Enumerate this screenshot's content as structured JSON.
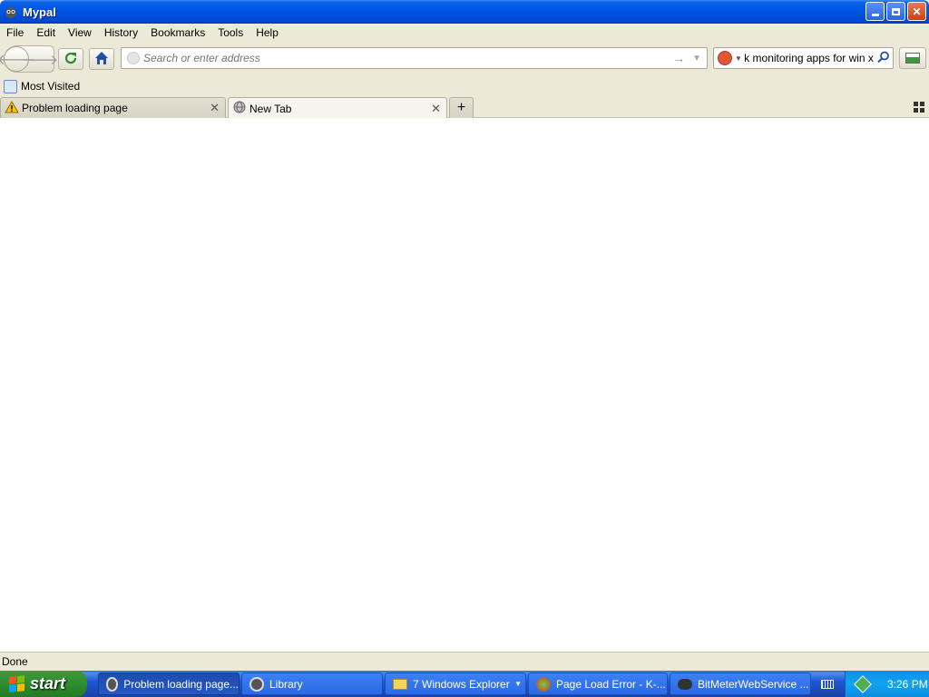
{
  "window": {
    "title": "Mypal"
  },
  "menubar": {
    "items": [
      "File",
      "Edit",
      "View",
      "History",
      "Bookmarks",
      "Tools",
      "Help"
    ]
  },
  "navbar": {
    "url_placeholder": "Search or enter address",
    "search_value": "ork monitoring apps for win x"
  },
  "bookmarks": {
    "items": [
      "Most Visited"
    ]
  },
  "tabs": [
    {
      "label": "Problem loading page",
      "state": "inactive",
      "icon": "warning-icon"
    },
    {
      "label": "New Tab",
      "state": "active",
      "icon": "globe-icon"
    }
  ],
  "status": {
    "text": "Done"
  },
  "taskbar": {
    "start_label": "start",
    "tasks": [
      {
        "label": "Problem loading page...",
        "icon": "mypal-icon",
        "active": true
      },
      {
        "label": "Library",
        "icon": "mypal-icon",
        "active": false
      },
      {
        "label": "7 Windows Explorer",
        "icon": "folder-icon",
        "active": false
      },
      {
        "label": "Page Load Error - K-...",
        "icon": "kmeleon-icon",
        "active": false
      },
      {
        "label": "BitMeterWebService ...",
        "icon": "app-icon",
        "active": false
      }
    ],
    "clock": "3:26 PM"
  },
  "colors": {
    "titlebar": "#0055e5",
    "chrome": "#ece9d8",
    "taskbar": "#2157d7",
    "start": "#2f8c2f"
  }
}
